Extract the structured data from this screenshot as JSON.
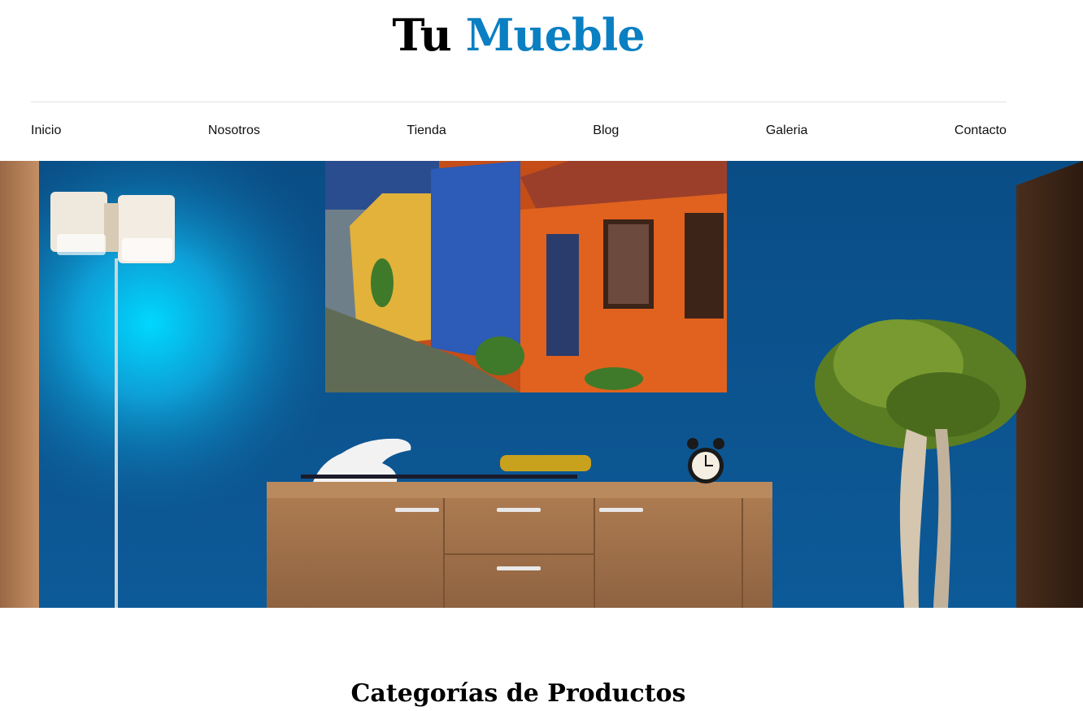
{
  "header": {
    "logo_part1": "Tu",
    "logo_part2": "Mueble"
  },
  "nav": {
    "items": [
      {
        "label": "Inicio"
      },
      {
        "label": "Nosotros"
      },
      {
        "label": "Tienda"
      },
      {
        "label": "Blog"
      },
      {
        "label": "Galeria"
      },
      {
        "label": "Contacto"
      }
    ]
  },
  "hero": {
    "image": "hero-banner-living-room"
  },
  "sections": {
    "categories_title": "Categorías de Productos"
  },
  "colors": {
    "accent": "#0a7fc1",
    "wall": "#0b4f86",
    "wood": "#a5744c"
  }
}
